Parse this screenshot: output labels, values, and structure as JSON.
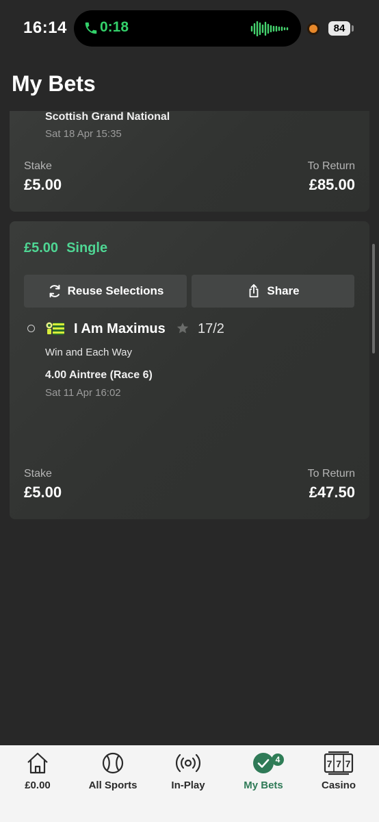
{
  "status_bar": {
    "time": "16:14",
    "call_timer": "0:18",
    "battery": "84"
  },
  "page": {
    "title": "My Bets"
  },
  "bets": [
    {
      "event": "Scottish Grand National",
      "date": "Sat 18 Apr 15:35",
      "stake_label": "Stake",
      "stake": "£5.00",
      "return_label": "To Return",
      "return": "£85.00"
    },
    {
      "stake_amount": "£5.00",
      "bet_type": "Single",
      "reuse_label": "Reuse Selections",
      "share_label": "Share",
      "selection": {
        "runner": "I Am Maximus",
        "odds": "17/2",
        "market": "Win and Each Way",
        "race": "4.00 Aintree (Race 6)",
        "date": "Sat 11 Apr 16:02"
      },
      "stake_label": "Stake",
      "stake": "£5.00",
      "return_label": "To Return",
      "return": "£47.50"
    }
  ],
  "nav": {
    "items": [
      {
        "label": "£0.00",
        "icon": "home-icon"
      },
      {
        "label": "All Sports",
        "icon": "tennis-ball-icon"
      },
      {
        "label": "In-Play",
        "icon": "broadcast-icon"
      },
      {
        "label": "My Bets",
        "icon": "check-circle-icon",
        "badge": "4",
        "active": true
      },
      {
        "label": "Casino",
        "icon": "slot-machine-icon"
      }
    ]
  },
  "colors": {
    "background": "#282828",
    "card": "#343634",
    "accent_green": "#4fd694",
    "nav_active": "#2f7a57",
    "nav_background": "#f4f4f4"
  }
}
